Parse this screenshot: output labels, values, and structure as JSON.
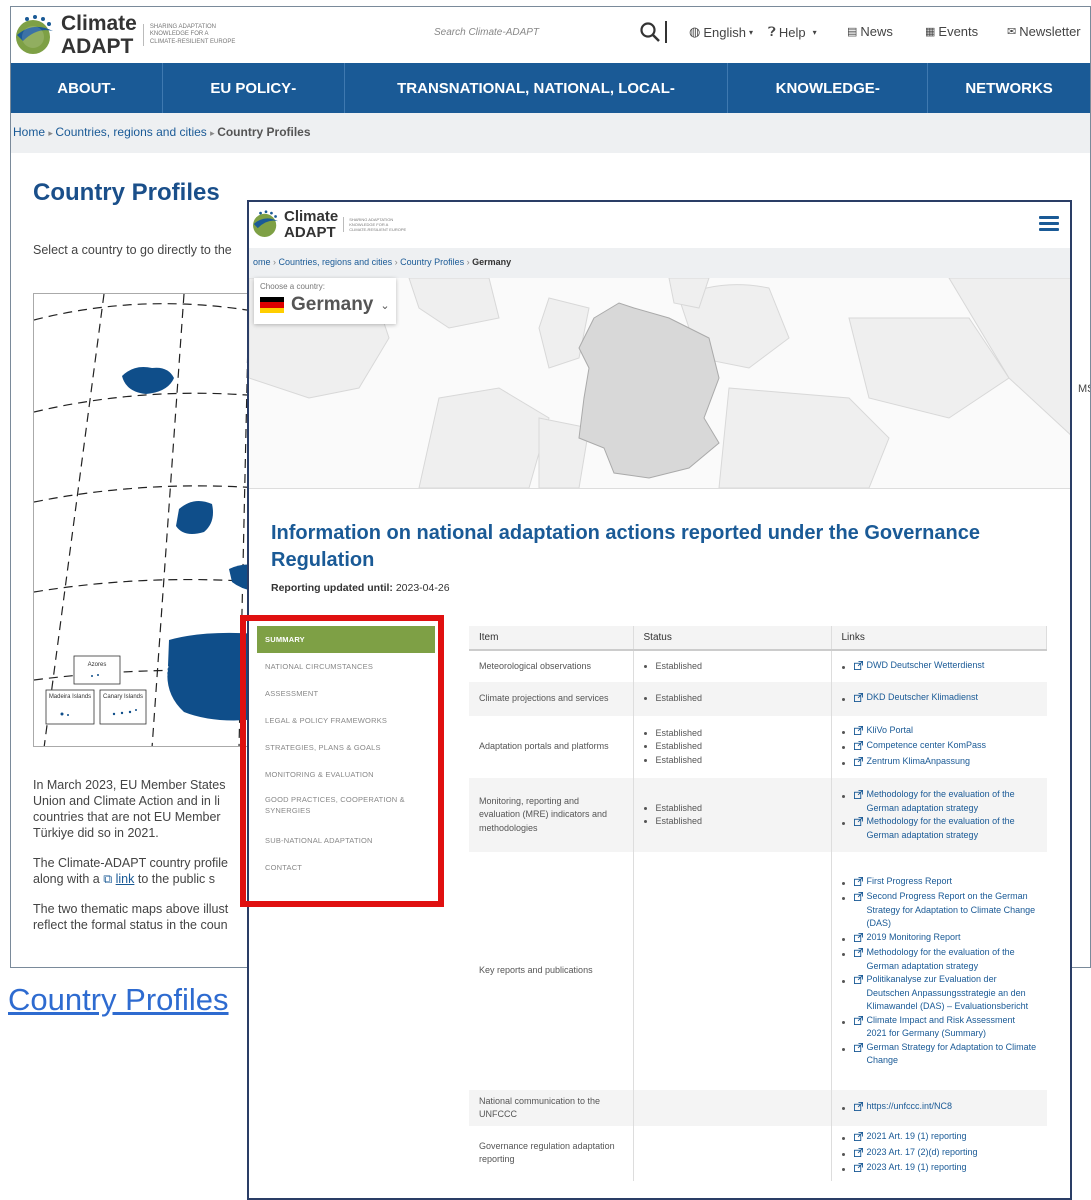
{
  "back": {
    "logo": {
      "title1": "Climate",
      "title2": "ADAPT",
      "tagline": [
        "SHARING ADAPTATION",
        "KNOWLEDGE FOR A",
        "CLIMATE-RESILIENT EUROPE"
      ]
    },
    "search_placeholder": "Search Climate-ADAPT",
    "header_links": {
      "language": "English",
      "help": "Help",
      "news": "News",
      "events": "Events",
      "newsletter": "Newsletter"
    },
    "nav": [
      "ABOUT",
      "EU POLICY",
      "TRANSNATIONAL, NATIONAL, LOCAL",
      "KNOWLEDGE",
      "NETWORKS"
    ],
    "breadcrumb": {
      "home": "Home",
      "level2": "Countries, regions and cities",
      "current": "Country Profiles"
    },
    "title": "Country Profiles",
    "intro": "Select a country to go directly to the",
    "map_labels": {
      "azores": "Azores",
      "madeira": "Madeira Islands",
      "canary": "Canary Islands"
    },
    "paragraphs": {
      "p1_l1": "In March 2023, EU Member States",
      "p1_l2": "Union and Climate Action and in li",
      "p1_l3": "countries that are not EU Member",
      "p1_l4": "Türkiye did so in 2021.",
      "p2_l1": "The Climate-ADAPT country profile",
      "p2_l2_pre": "along with a",
      "p2_l2_link": "link",
      "p2_l2_post": "to the public s",
      "p3_l1": "The two thematic maps above illust",
      "p3_l2": "reflect the formal status in the coun"
    },
    "ms_fragment": "MS"
  },
  "bottom_link": "Country Profiles",
  "front": {
    "logo": {
      "title1": "Climate",
      "title2": "ADAPT",
      "tagline": [
        "SHARING ADAPTATION",
        "KNOWLEDGE FOR A",
        "CLIMATE-RESILIENT EUROPE"
      ]
    },
    "breadcrumb": {
      "home": "ome",
      "level2": "Countries, regions and cities",
      "level3": "Country Profiles",
      "current": "Germany"
    },
    "chooser": {
      "label": "Choose a country:",
      "value": "Germany"
    },
    "heading": "Information on national adaptation actions reported under the Governance Regulation",
    "updated_label": "Reporting updated until:",
    "updated_value": "2023-04-26",
    "sidebar": [
      "SUMMARY",
      "NATIONAL CIRCUMSTANCES",
      "ASSESSMENT",
      "LEGAL & POLICY FRAMEWORKS",
      "STRATEGIES, PLANS & GOALS",
      "MONITORING & EVALUATION",
      "GOOD PRACTICES, COOPERATION & SYNERGIES",
      "SUB-NATIONAL ADAPTATION",
      "CONTACT"
    ],
    "table": {
      "headers": [
        "Item",
        "Status",
        "Links"
      ],
      "rows": [
        {
          "item": "Meteorological observations",
          "status": [
            "Established"
          ],
          "links": [
            "DWD Deutscher Wetterdienst"
          ]
        },
        {
          "item": "Climate projections and services",
          "status": [
            "Established"
          ],
          "links": [
            "DKD Deutscher Klimadienst"
          ]
        },
        {
          "item": "Adaptation portals and platforms",
          "status": [
            "Established",
            "Established",
            "Established"
          ],
          "links": [
            "KliVo Portal",
            "Competence center KomPass",
            "Zentrum KlimaAnpassung"
          ]
        },
        {
          "item": "Monitoring, reporting and evaluation (MRE) indicators and methodologies",
          "status": [
            "Established",
            "Established"
          ],
          "links": [
            "Methodology for the evaluation of the German adaptation strategy",
            "Methodology for the evaluation of the German adaptation strategy"
          ]
        },
        {
          "item": "Key reports and publications",
          "status": [],
          "links": [
            "First Progress Report",
            "Second Progress Report on the German Strategy for Adaptation to Climate Change (DAS)",
            "2019 Monitoring Report",
            "Methodology for the evaluation of the German adaptation strategy",
            "Politikanalyse zur Evaluation der Deutschen Anpassungsstrategie an den Klimawandel (DAS) – Evaluationsbericht",
            "Climate Impact and Risk Assessment 2021 for Germany (Summary)",
            "German Strategy for Adaptation to Climate Change"
          ]
        },
        {
          "item": "National communication to the UNFCCC",
          "status": [],
          "links": [
            "https://unfccc.int/NC8"
          ]
        },
        {
          "item": "Governance regulation adaptation reporting",
          "status": [],
          "links": [
            "2021 Art. 19 (1) reporting",
            "2023 Art. 17 (2)(d) reporting",
            "2023 Art. 19 (1) reporting"
          ]
        }
      ]
    }
  },
  "colors": {
    "brand_blue": "#1a5a96",
    "nav_blue": "#1a5a96",
    "sidebar_active": "#7ea045",
    "highlight_red": "#e01010",
    "germany_fill": "#d8d8d8",
    "map_country_blue": "#0f4e8a"
  }
}
